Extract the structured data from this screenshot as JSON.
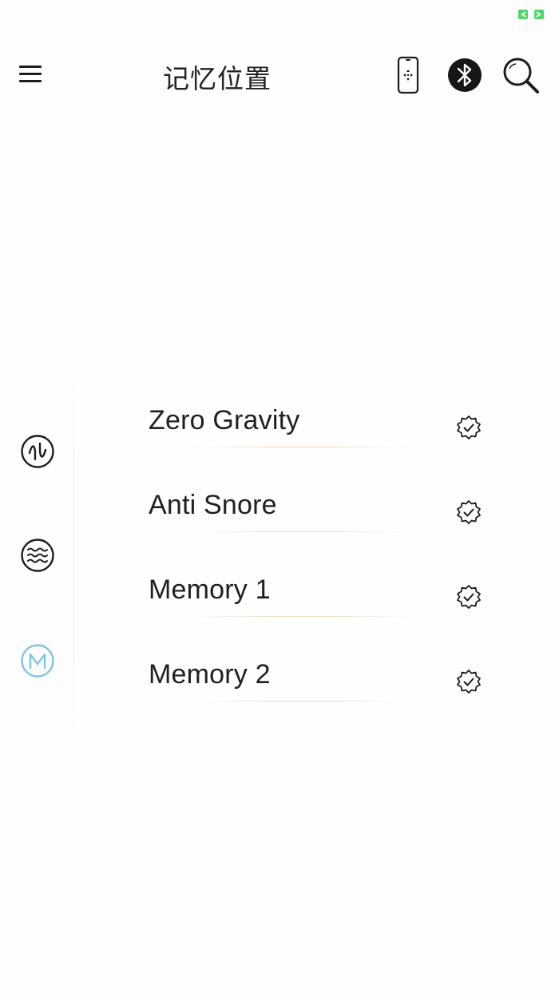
{
  "status": {
    "indicator_icon": "green-battery-icon",
    "indicator_color": "#4cd964"
  },
  "header": {
    "title": "记忆位置",
    "menu_icon": "hamburger-menu-icon",
    "phone_icon": "remote-phone-icon",
    "bluetooth_icon": "bluetooth-icon",
    "search_icon": "search-icon"
  },
  "sidebar": {
    "items": [
      {
        "icon": "massage-wave-icon",
        "active": false
      },
      {
        "icon": "water-wave-icon",
        "active": false
      },
      {
        "icon": "memory-m-icon",
        "active": true
      }
    ],
    "active_color": "#7ec3e8",
    "inactive_color": "#1c1c1c"
  },
  "memory_list": {
    "items": [
      {
        "label": "Zero Gravity",
        "icon": "verified-badge-icon"
      },
      {
        "label": "Anti Snore",
        "icon": "verified-badge-icon"
      },
      {
        "label": "Memory 1",
        "icon": "verified-badge-icon"
      },
      {
        "label": "Memory 2",
        "icon": "verified-badge-icon"
      }
    ]
  }
}
